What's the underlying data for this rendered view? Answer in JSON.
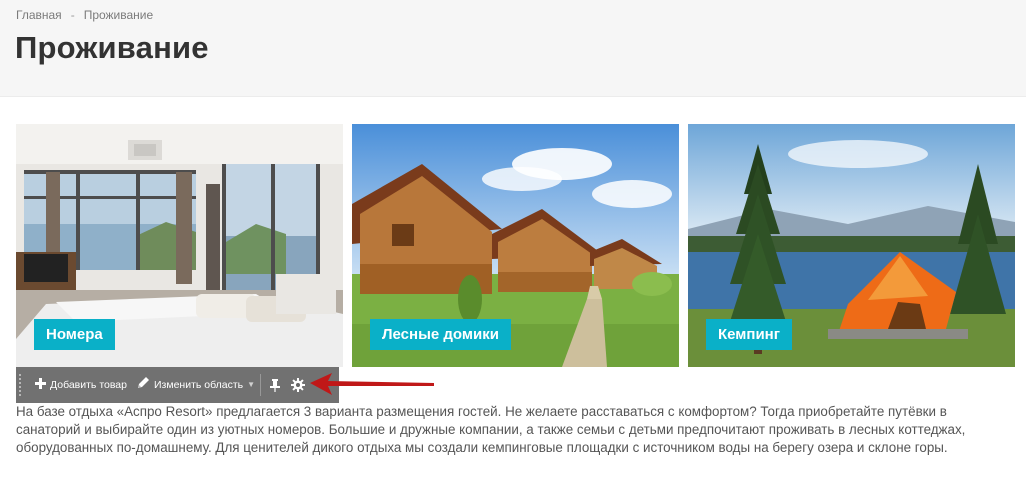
{
  "breadcrumbs": [
    {
      "label": "Главная"
    },
    {
      "label": "Проживание"
    }
  ],
  "breadcrumb_separator": "-",
  "page_title": "Проживание",
  "cards": [
    {
      "label": "Номера",
      "icon": "bedroom-photo"
    },
    {
      "label": "Лесные домики",
      "icon": "cabins-photo"
    },
    {
      "label": "Кемпинг",
      "icon": "tent-photo"
    }
  ],
  "admin_toolbar": {
    "add_product_label": "Добавить товар",
    "edit_area_label": "Изменить область",
    "add_icon": "plus-icon",
    "edit_icon": "pencil-icon",
    "pin_icon": "pin-icon",
    "settings_icon": "gear-icon"
  },
  "description": "На базе отдыха «Аспро Resort» предлагается 3 варианта размещения гостей. Не желаете расставаться с комфортом? Тогда приобретайте путёвки в санаторий и выбирайте один из уютных номеров. Большие и дружные компании, а также семьи с детьми предпочитают проживать в лесных коттеджах, оборудованных по-домашнему.  Для ценителей дикого отдыха мы создали кемпинговые площадки с источником воды на берегу озера и склоне горы.",
  "colors": {
    "accent": "#0ab0c8",
    "header_bg": "#f6f6f6",
    "toolbar_bg": "#666666",
    "annotation_arrow": "#c01818"
  }
}
